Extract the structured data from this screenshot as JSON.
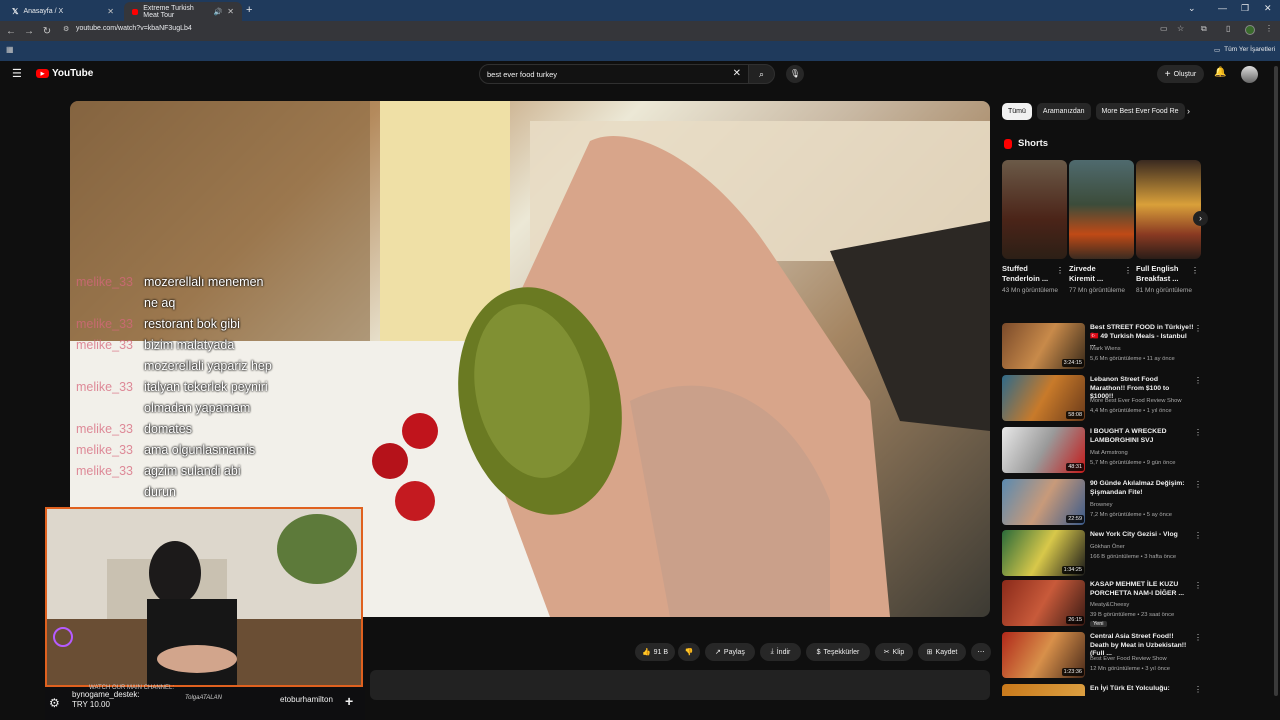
{
  "browser": {
    "tabs": [
      {
        "title": "Anasayfa / X",
        "icon": "x-logo-icon"
      },
      {
        "title": "Extreme Turkish Meat Tour",
        "icon": "youtube-icon"
      }
    ],
    "url": "youtube.com/watch?v=kbaNF3ugLb4",
    "bookmarks_label": "Tüm Yer İşaretleri"
  },
  "youtube": {
    "logo_text": "YouTube",
    "search_value": "best ever food turkey",
    "create_label": "Oluştur"
  },
  "chat": [
    {
      "user": "melike_33",
      "msg": "mozerellalı menemen"
    },
    {
      "user": "",
      "msg": "ne aq"
    },
    {
      "user": "melike_33",
      "msg": "restorant bok gibi"
    },
    {
      "user": "melike_33",
      "msg": "bizim malatyada"
    },
    {
      "user": "",
      "msg": "mozerellali yapariz hep"
    },
    {
      "user": "melike_33",
      "msg": "italyan tekerlek peyniri"
    },
    {
      "user": "",
      "msg": "olmadan yapamam"
    },
    {
      "user": "melike_33",
      "msg": "domates"
    },
    {
      "user": "melike_33",
      "msg": "ama olgunlasmamis"
    },
    {
      "user": "melike_33",
      "msg": "agzim sulandi abi"
    },
    {
      "user": "",
      "msg": "durun"
    }
  ],
  "stream": {
    "donation_user": "bynogame_destek:",
    "donation_amount": "TRY 10.00",
    "watermark": "TolgaATALAN",
    "mid_text": "WATCH OUR MAIN CHANNEL: ",
    "right_user": "etoburhamilton"
  },
  "actions": {
    "like_count": "91 B",
    "share": "Paylaş",
    "download": "İndir",
    "thanks": "Teşekkürler",
    "clip": "Klip",
    "save": "Kaydet"
  },
  "chips": [
    "Tümü",
    "Aramanızdan",
    "More Best Ever Food Re"
  ],
  "shorts_title": "Shorts",
  "shorts": [
    {
      "title": "Stuffed Tenderloin ...",
      "views": "43 Mn görüntüleme"
    },
    {
      "title": "Zirvede Kiremit ...",
      "views": "77 Mn görüntüleme"
    },
    {
      "title": "Full English Breakfast ...",
      "views": "81 Mn görüntüleme"
    }
  ],
  "recommendations": [
    {
      "title": "Best STREET FOOD in Türkiye!! 🇹🇷 49 Turkish Meals - Istanbul ...",
      "channel": "Mark Wiens",
      "meta": "5,6 Mn görüntüleme • 11 ay önce",
      "duration": "3:24:15"
    },
    {
      "title": "Lebanon Street Food Marathon!! From $100 to $1000!!",
      "channel": "More Best Ever Food Review Show",
      "meta": "4,4 Mn görüntüleme • 1 yıl önce",
      "duration": "58:08"
    },
    {
      "title": "I BOUGHT A WRECKED LAMBORGHINI SVJ",
      "channel": "Mat Armstrong",
      "meta": "5,7 Mn görüntüleme • 9 gün önce",
      "duration": "48:31"
    },
    {
      "title": "90 Günde Akılalmaz Değişim: Şişmandan Fite!",
      "channel": "Browney",
      "meta": "7,2 Mn görüntüleme • 5 ay önce",
      "duration": "22:59"
    },
    {
      "title": "New York City Gezisi - Vlog",
      "channel": "Gökhan Öner",
      "meta": "166 B görüntüleme • 3 hafta önce",
      "duration": "1:34:25"
    },
    {
      "title": "KASAP MEHMET İLE KUZU PORCHETTA NAM-I DİĞER ...",
      "channel": "Meaty&Cheesy",
      "meta": "39 B görüntüleme • 23 saat önce",
      "badge": "Yeni",
      "duration": "26:15"
    },
    {
      "title": "Central Asia Street Food!! Death by Meat in Uzbekistan!! (Full ...",
      "channel": "Best Ever Food Review Show",
      "meta": "12 Mn görüntüleme • 3 yıl önce",
      "duration": "1:23:36"
    },
    {
      "title": "En İyi Türk Et Yolculuğu:",
      "channel": "",
      "meta": "",
      "duration": ""
    }
  ]
}
